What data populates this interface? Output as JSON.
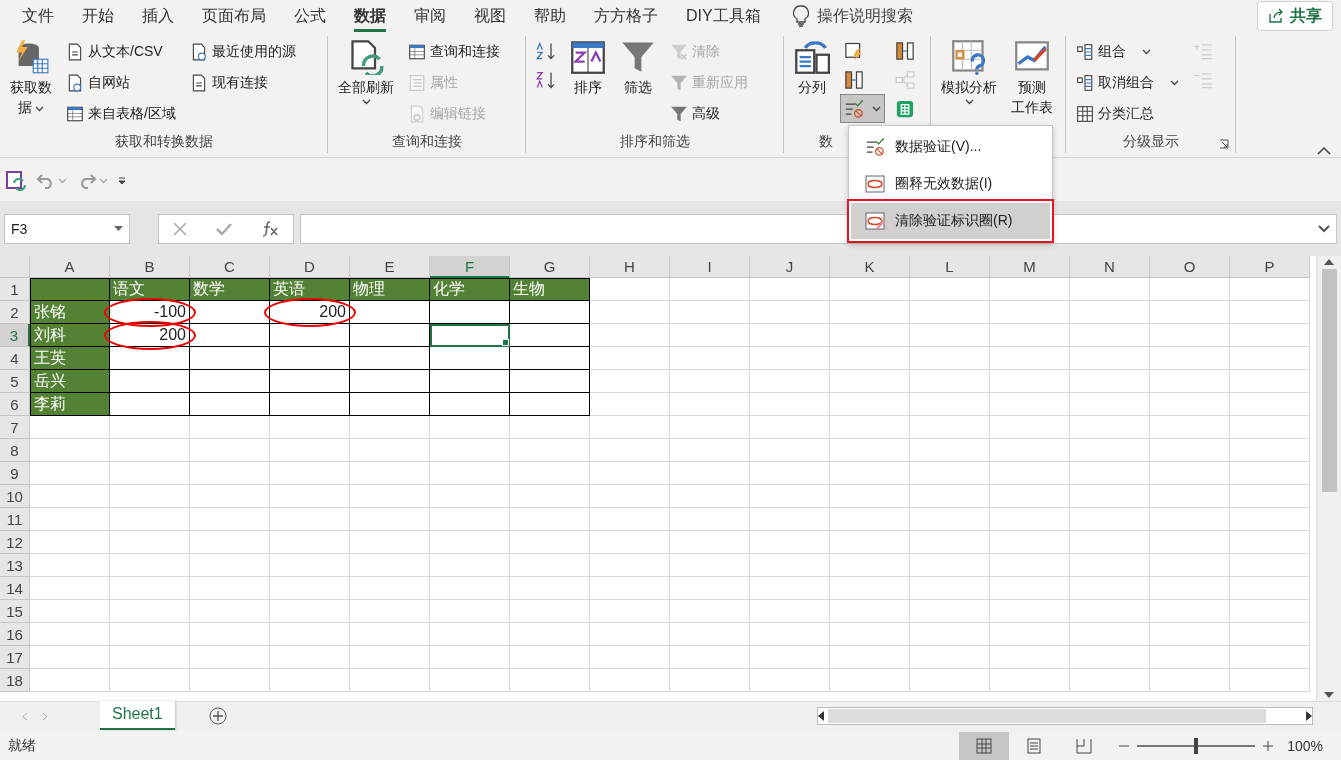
{
  "ribbon_tabs": [
    {
      "label": "文件",
      "selected": false
    },
    {
      "label": "开始",
      "selected": false
    },
    {
      "label": "插入",
      "selected": false
    },
    {
      "label": "页面布局",
      "selected": false
    },
    {
      "label": "公式",
      "selected": false
    },
    {
      "label": "数据",
      "selected": true
    },
    {
      "label": "审阅",
      "selected": false
    },
    {
      "label": "视图",
      "selected": false
    },
    {
      "label": "帮助",
      "selected": false
    },
    {
      "label": "方方格子",
      "selected": false
    },
    {
      "label": "DIY工具箱",
      "selected": false
    }
  ],
  "tell_me": {
    "label": "操作说明搜索"
  },
  "share_button": {
    "label": "共享"
  },
  "ribbon_groups": [
    {
      "label": "获取和转换数据",
      "columns": [
        [
          {
            "kind": "large",
            "label_lines": [
              "获取数",
              "据"
            ],
            "caret": true,
            "disabled": false,
            "pressed": false
          }
        ],
        [
          {
            "kind": "small",
            "label": "从文本/CSV",
            "caret": false,
            "disabled": false,
            "pressed": false
          },
          {
            "kind": "small",
            "label": "自网站",
            "caret": false,
            "disabled": false,
            "pressed": false
          },
          {
            "kind": "small",
            "label": "来自表格/区域",
            "caret": false,
            "disabled": false,
            "pressed": false
          }
        ],
        [
          {
            "kind": "small",
            "label": "最近使用的源",
            "caret": false,
            "disabled": false,
            "pressed": false
          },
          {
            "kind": "small",
            "label": "现有连接",
            "caret": false,
            "disabled": false,
            "pressed": false
          }
        ]
      ]
    },
    {
      "label": "查询和连接",
      "columns": [
        [
          {
            "kind": "large",
            "label_lines": [
              "全部刷新"
            ],
            "caret": true,
            "disabled": false,
            "pressed": false
          }
        ],
        [
          {
            "kind": "small",
            "label": "查询和连接",
            "caret": false,
            "disabled": false,
            "pressed": false
          },
          {
            "kind": "small",
            "label": "属性",
            "caret": false,
            "disabled": true,
            "pressed": false
          },
          {
            "kind": "small",
            "label": "编辑链接",
            "caret": false,
            "disabled": true,
            "pressed": false
          }
        ]
      ]
    },
    {
      "label": "排序和筛选",
      "columns": [
        [
          {
            "kind": "icon",
            "caret": false,
            "disabled": false,
            "pressed": false
          },
          {
            "kind": "icon",
            "caret": false,
            "disabled": false,
            "pressed": false
          }
        ],
        [
          {
            "kind": "large",
            "label_lines": [
              "排序"
            ],
            "caret": false,
            "disabled": false,
            "pressed": false
          }
        ],
        [
          {
            "kind": "large",
            "label_lines": [
              "筛选"
            ],
            "caret": false,
            "disabled": false,
            "pressed": false
          }
        ],
        [
          {
            "kind": "small",
            "label": "清除",
            "caret": false,
            "disabled": true,
            "pressed": false
          },
          {
            "kind": "small",
            "label": "重新应用",
            "caret": false,
            "disabled": true,
            "pressed": false
          },
          {
            "kind": "small",
            "label": "高级",
            "caret": false,
            "disabled": false,
            "pressed": false
          }
        ]
      ]
    },
    {
      "label": "数",
      "columns": [
        [
          {
            "kind": "large",
            "label_lines": [
              "分列"
            ],
            "caret": false,
            "disabled": false,
            "pressed": false
          }
        ],
        [
          {
            "kind": "icon",
            "caret": false,
            "disabled": false,
            "pressed": false
          },
          {
            "kind": "icon",
            "caret": false,
            "disabled": false,
            "pressed": false
          },
          {
            "kind": "icon",
            "caret": true,
            "disabled": false,
            "pressed": true
          }
        ],
        [
          {
            "kind": "icon",
            "caret": false,
            "disabled": false,
            "pressed": false
          },
          {
            "kind": "icon",
            "caret": false,
            "disabled": true,
            "pressed": false
          },
          {
            "kind": "icon",
            "caret": false,
            "disabled": false,
            "pressed": false
          }
        ]
      ]
    },
    {
      "columns": [
        [
          {
            "kind": "large",
            "label_lines": [
              "模拟分析"
            ],
            "caret": true,
            "disabled": false,
            "pressed": false
          }
        ],
        [
          {
            "kind": "large",
            "label_lines": [
              "预测",
              "工作表"
            ],
            "caret": false,
            "disabled": false,
            "pressed": false
          }
        ]
      ]
    },
    {
      "label": "分级显示",
      "columns": [
        [
          {
            "kind": "small",
            "label": "组合",
            "caret": true,
            "disabled": false,
            "pressed": false
          },
          {
            "kind": "small",
            "label": "取消组合",
            "caret": true,
            "disabled": false,
            "pressed": false
          },
          {
            "kind": "small",
            "label": "分类汇总",
            "caret": false,
            "disabled": false,
            "pressed": false
          }
        ],
        [
          {
            "kind": "icon",
            "caret": false,
            "disabled": true,
            "pressed": false
          },
          {
            "kind": "icon",
            "caret": false,
            "disabled": true,
            "pressed": false
          }
        ]
      ]
    }
  ],
  "dropdown_menu": [
    {
      "label": "数据验证(V)...",
      "selected": false,
      "annotated": false
    },
    {
      "label": "圈释无效数据(I)",
      "selected": false,
      "annotated": false
    },
    {
      "label": "清除验证标识圈(R)",
      "selected": true,
      "annotated": true
    }
  ],
  "name_box": {
    "value": "F3"
  },
  "columns": [
    {
      "label": "A",
      "selected": false
    },
    {
      "label": "B",
      "selected": false
    },
    {
      "label": "C",
      "selected": false
    },
    {
      "label": "D",
      "selected": false
    },
    {
      "label": "E",
      "selected": false
    },
    {
      "label": "F",
      "selected": true
    },
    {
      "label": "G",
      "selected": false
    },
    {
      "label": "H",
      "selected": false
    },
    {
      "label": "I",
      "selected": false
    },
    {
      "label": "J",
      "selected": false
    },
    {
      "label": "K",
      "selected": false
    },
    {
      "label": "L",
      "selected": false
    },
    {
      "label": "M",
      "selected": false
    },
    {
      "label": "N",
      "selected": false
    },
    {
      "label": "O",
      "selected": false
    },
    {
      "label": "P",
      "selected": false
    }
  ],
  "rows": [
    {
      "label": "1",
      "selected": false,
      "cells": [
        {
          "kind": "empty",
          "filled": true,
          "circled": false,
          "selected": false
        },
        {
          "kind": "text",
          "text": "语文",
          "filled": true,
          "circled": false,
          "selected": false
        },
        {
          "kind": "text",
          "text": "数学",
          "filled": true,
          "circled": false,
          "selected": false
        },
        {
          "kind": "text",
          "text": "英语",
          "filled": true,
          "circled": false,
          "selected": false
        },
        {
          "kind": "text",
          "text": "物理",
          "filled": true,
          "circled": false,
          "selected": false
        },
        {
          "kind": "text",
          "text": "化学",
          "filled": true,
          "circled": false,
          "selected": false
        },
        {
          "kind": "text",
          "text": "生物",
          "filled": true,
          "circled": false,
          "selected": false
        }
      ]
    },
    {
      "label": "2",
      "selected": false,
      "cells": [
        {
          "kind": "text",
          "text": "张铭",
          "filled": true,
          "circled": false,
          "selected": false
        },
        {
          "kind": "number",
          "text": "-100",
          "filled": false,
          "circled": true,
          "selected": false
        },
        {
          "kind": "empty",
          "filled": false,
          "circled": false,
          "selected": false
        },
        {
          "kind": "number",
          "text": "200",
          "filled": false,
          "circled": true,
          "selected": false
        },
        {
          "kind": "empty",
          "filled": false,
          "circled": false,
          "selected": false
        },
        {
          "kind": "empty",
          "filled": false,
          "circled": false,
          "selected": false
        },
        {
          "kind": "empty",
          "filled": false,
          "circled": false,
          "selected": false
        }
      ]
    },
    {
      "label": "3",
      "selected": true,
      "cells": [
        {
          "kind": "text",
          "text": "刘科",
          "filled": true,
          "circled": false,
          "selected": false
        },
        {
          "kind": "number",
          "text": "200",
          "filled": false,
          "circled": true,
          "selected": false
        },
        {
          "kind": "empty",
          "filled": false,
          "circled": false,
          "selected": false
        },
        {
          "kind": "empty",
          "filled": false,
          "circled": false,
          "selected": false
        },
        {
          "kind": "empty",
          "filled": false,
          "circled": false,
          "selected": false
        },
        {
          "kind": "empty",
          "filled": false,
          "circled": false,
          "selected": true
        },
        {
          "kind": "empty",
          "filled": false,
          "circled": false,
          "selected": false
        }
      ]
    },
    {
      "label": "4",
      "selected": false,
      "cells": [
        {
          "kind": "text",
          "text": "王英",
          "filled": true,
          "circled": false,
          "selected": false
        },
        {
          "kind": "empty",
          "filled": false,
          "circled": false,
          "selected": false
        },
        {
          "kind": "empty",
          "filled": false,
          "circled": false,
          "selected": false
        },
        {
          "kind": "empty",
          "filled": false,
          "circled": false,
          "selected": false
        },
        {
          "kind": "empty",
          "filled": false,
          "circled": false,
          "selected": false
        },
        {
          "kind": "empty",
          "filled": false,
          "circled": false,
          "selected": false
        },
        {
          "kind": "empty",
          "filled": false,
          "circled": false,
          "selected": false
        }
      ]
    },
    {
      "label": "5",
      "selected": false,
      "cells": [
        {
          "kind": "text",
          "text": "岳兴",
          "filled": true,
          "circled": false,
          "selected": false
        },
        {
          "kind": "empty",
          "filled": false,
          "circled": false,
          "selected": false
        },
        {
          "kind": "empty",
          "filled": false,
          "circled": false,
          "selected": false
        },
        {
          "kind": "empty",
          "filled": false,
          "circled": false,
          "selected": false
        },
        {
          "kind": "empty",
          "filled": false,
          "circled": false,
          "selected": false
        },
        {
          "kind": "empty",
          "filled": false,
          "circled": false,
          "selected": false
        },
        {
          "kind": "empty",
          "filled": false,
          "circled": false,
          "selected": false
        }
      ]
    },
    {
      "label": "6",
      "selected": false,
      "cells": [
        {
          "kind": "text",
          "text": "李莉",
          "filled": true,
          "circled": false,
          "selected": false
        },
        {
          "kind": "empty",
          "filled": false,
          "circled": false,
          "selected": false
        },
        {
          "kind": "empty",
          "filled": false,
          "circled": false,
          "selected": false
        },
        {
          "kind": "empty",
          "filled": false,
          "circled": false,
          "selected": false
        },
        {
          "kind": "empty",
          "filled": false,
          "circled": false,
          "selected": false
        },
        {
          "kind": "empty",
          "filled": false,
          "circled": false,
          "selected": false
        },
        {
          "kind": "empty",
          "filled": false,
          "circled": false,
          "selected": false
        }
      ]
    },
    {
      "label": "7",
      "selected": false
    },
    {
      "label": "8",
      "selected": false
    },
    {
      "label": "9",
      "selected": false
    },
    {
      "label": "10",
      "selected": false
    },
    {
      "label": "11",
      "selected": false
    },
    {
      "label": "12",
      "selected": false
    },
    {
      "label": "13",
      "selected": false
    },
    {
      "label": "14",
      "selected": false
    },
    {
      "label": "15",
      "selected": false
    },
    {
      "label": "16",
      "selected": false
    },
    {
      "label": "17",
      "selected": false
    },
    {
      "label": "18",
      "selected": false
    }
  ],
  "sheet_tabs": [
    {
      "label": "Sheet1",
      "selected": true
    }
  ],
  "status_bar": {
    "text": "就绪",
    "views": [
      {
        "selected": true
      },
      {
        "selected": false
      },
      {
        "selected": false
      }
    ],
    "zoom": {
      "level": 0.5,
      "reading": "100%"
    }
  }
}
